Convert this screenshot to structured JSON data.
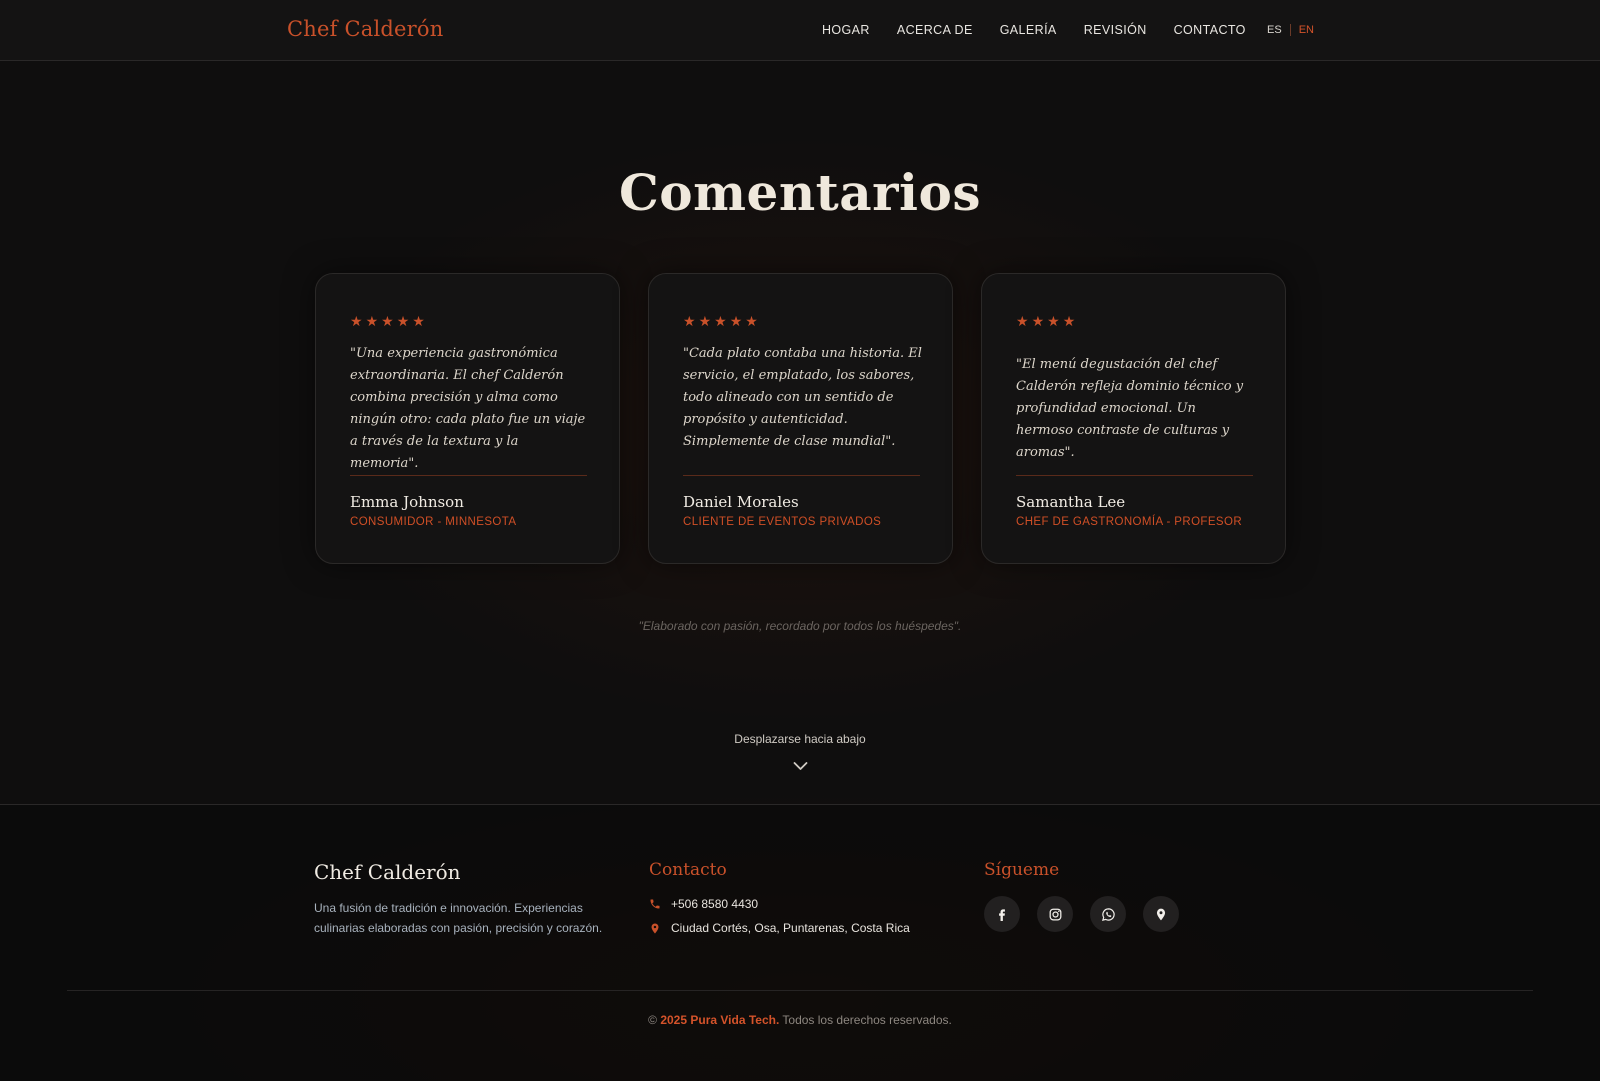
{
  "header": {
    "brand": "Chef Calderón",
    "nav": [
      "HOGAR",
      "ACERCA DE",
      "GALERÍA",
      "REVISIÓN",
      "CONTACTO"
    ],
    "lang": {
      "es": "ES",
      "en": "EN",
      "active": "EN"
    }
  },
  "main": {
    "title": "Comentarios",
    "reviews": [
      {
        "stars": 5,
        "quote": "\"Una experiencia gastronómica extraordinaria. El chef Calderón combina precisión y alma como ningún otro: cada plato fue un viaje a través de la textura y la memoria\".",
        "name": "Emma Johnson",
        "role": "CONSUMIDOR - MINNESOTA"
      },
      {
        "stars": 5,
        "quote": "\"Cada plato contaba una historia. El servicio, el emplatado, los sabores, todo alineado con un sentido de propósito y autenticidad. Simplemente de clase mundial\".",
        "name": "Daniel Morales",
        "role": "CLIENTE DE EVENTOS PRIVADOS"
      },
      {
        "stars": 4,
        "quote": "\"El menú degustación del chef Calderón refleja dominio técnico y profundidad emocional. Un hermoso contraste de culturas y aromas\".",
        "name": "Samantha Lee",
        "role": "CHEF DE GASTRONOMÍA - PROFESOR"
      }
    ],
    "tagline": "\"Elaborado con pasión, recordado por todos los huéspedes\".",
    "scroll_label": "Desplazarse hacia abajo"
  },
  "footer": {
    "brand": "Chef Calderón",
    "description": "Una fusión de tradición e innovación. Experiencias culinarias elaboradas con pasión, precisión y corazón.",
    "contact_heading": "Contacto",
    "phone": "+506 8580 4430",
    "address": "Ciudad Cortés, Osa, Puntarenas, Costa Rica",
    "follow_heading": "Sígueme",
    "socials": [
      "facebook-icon",
      "instagram-icon",
      "whatsapp-icon",
      "location-icon"
    ],
    "copyright_prefix": "©",
    "copyright_highlight": "2025 Pura Vida Tech.",
    "copyright_rest": "Todos los derechos reservados."
  },
  "colors": {
    "accent": "#c9512a",
    "background": "#0f0e0e",
    "card": "#141313",
    "text": "#efe8dc"
  }
}
